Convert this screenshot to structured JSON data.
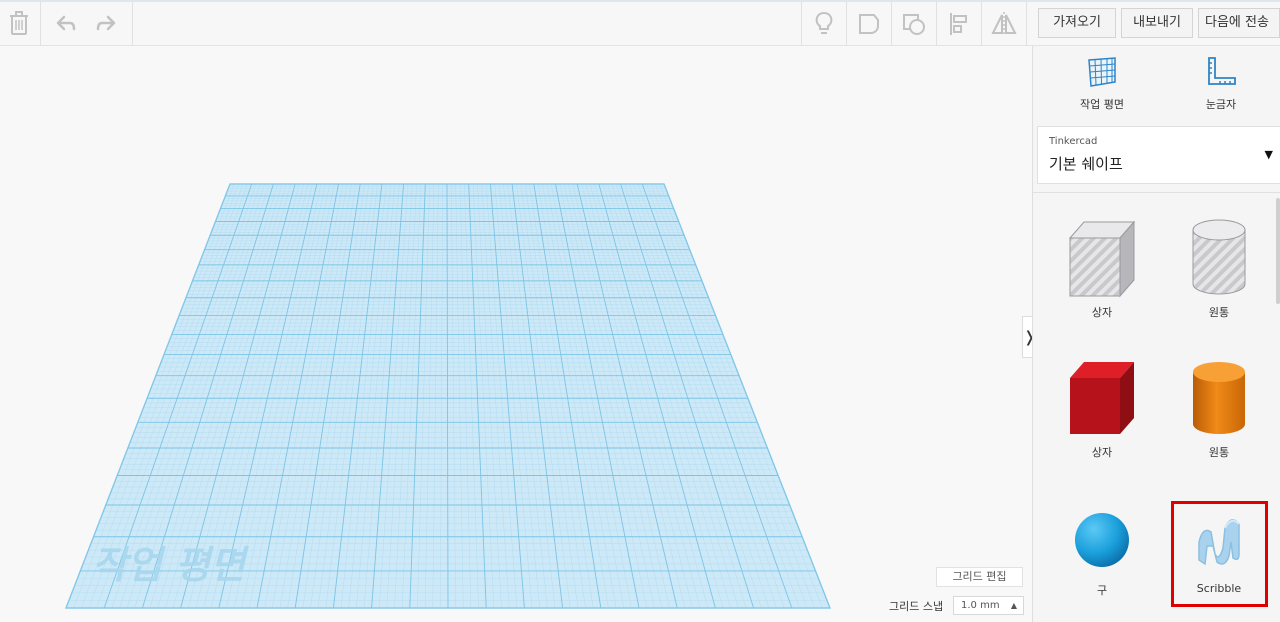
{
  "toolbar": {
    "icons": [
      "trash-icon",
      "undo-icon",
      "redo-icon",
      "lightbulb-icon",
      "note-icon",
      "group-icon",
      "align-icon",
      "mirror-icon"
    ],
    "import_label": "가져오기",
    "export_label": "내보내기",
    "send_to_label": "다음에 전송"
  },
  "workspace": {
    "plane_label": "작업 평면",
    "grid_edit_label": "그리드 편집",
    "snap_label": "그리드 스냅",
    "snap_value": "1.0 mm",
    "collapse_glyph": "❭"
  },
  "panel": {
    "workplane_label": "작업 평면",
    "ruler_label": "눈금자",
    "library_brand": "Tinkercad",
    "library_name": "기본 쉐이프",
    "shapes": [
      {
        "label": "상자",
        "kind": "box-hole"
      },
      {
        "label": "원통",
        "kind": "cylinder-hole"
      },
      {
        "label": "상자",
        "kind": "box"
      },
      {
        "label": "원통",
        "kind": "cylinder"
      },
      {
        "label": "구",
        "kind": "sphere"
      },
      {
        "label": "Scribble",
        "kind": "scribble"
      }
    ]
  },
  "colors": {
    "grid_fill": "#cde9f7",
    "grid_line": "#7cc4e6",
    "box_red": "#c8111b",
    "cylinder_orange": "#e07a10",
    "sphere_blue": "#1a9fdc",
    "scribble_blue": "#a9d2ee",
    "highlight": "#e00000"
  }
}
